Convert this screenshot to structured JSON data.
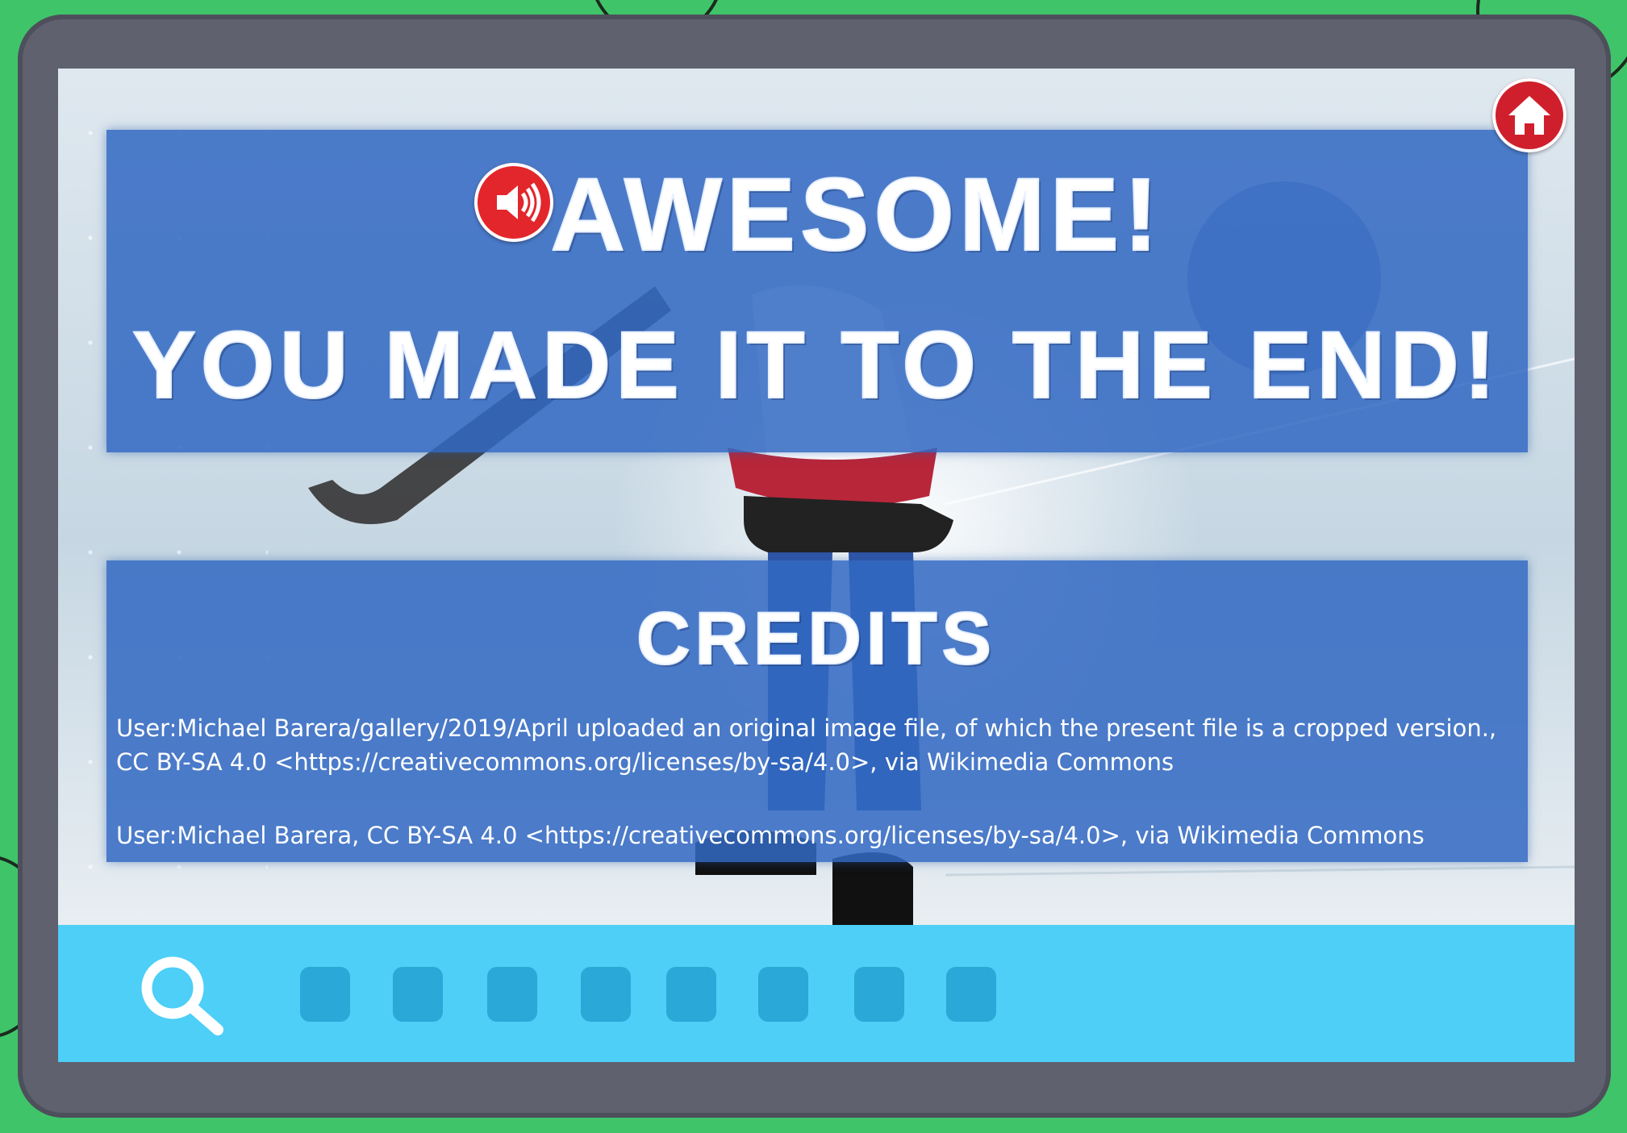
{
  "game": {
    "title_line1": "AWESOME!",
    "title_line2": "YOU MADE IT TO THE END!",
    "credits_heading": "CREDITS",
    "credits": [
      "User:Michael Barera/gallery/2019/April uploaded an original image file, of which the present file is a cropped version., CC BY-SA 4.0 <https://creativecommons.org/licenses/by-sa/4.0>, via Wikimedia Commons",
      "User:Michael Barera, CC BY-SA 4.0 <https://creativecommons.org/licenses/by-sa/4.0>, via Wikimedia Commons"
    ]
  },
  "buttons": {
    "sound_icon": "speaker-icon",
    "home_icon": "home-icon",
    "search_icon": "magnifier-icon"
  },
  "toolbar": {
    "slot_count": 8
  },
  "colors": {
    "frame": "#5f616e",
    "panel": "#3269c3",
    "toolbar": "#4dcff7",
    "slot": "#2aa8d8",
    "button_red": "#e3262b",
    "background_green": "#3fc46a"
  }
}
